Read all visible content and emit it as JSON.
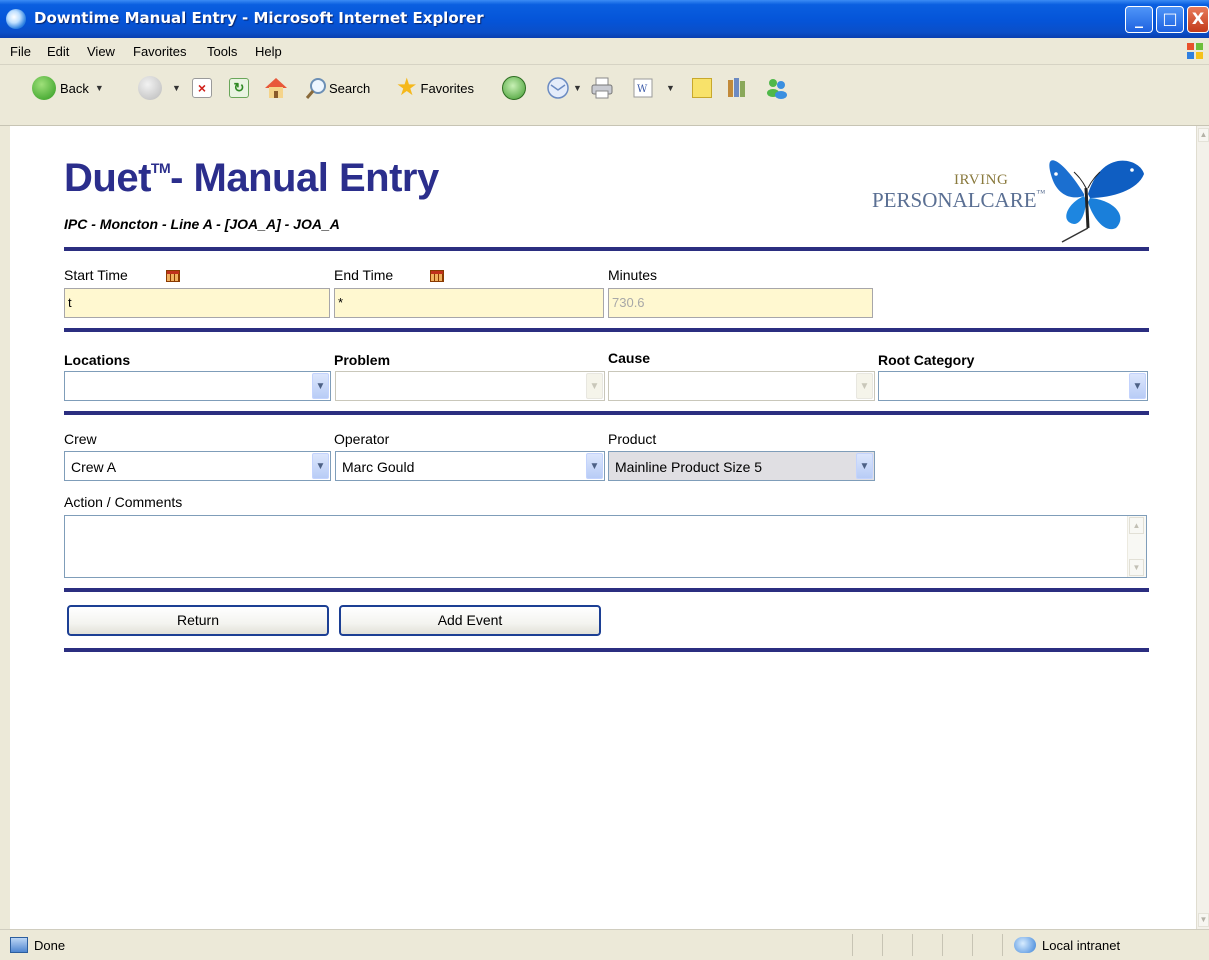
{
  "window": {
    "title": "Downtime Manual Entry - Microsoft Internet Explorer",
    "controls": {
      "minimize": "_",
      "maximize": "□",
      "close": "X"
    }
  },
  "menu": [
    "File",
    "Edit",
    "View",
    "Favorites",
    "Tools",
    "Help"
  ],
  "toolbar": {
    "back_label": "Back",
    "search_label": "Search",
    "favorites_label": "Favorites"
  },
  "page": {
    "title": "Duet",
    "title_tm": "TM",
    "title_rest": "- Manual Entry",
    "subtitle": "IPC - Moncton - Line A - [JOA_A] - JOA_A",
    "logo_line1": "IRVING",
    "logo_line2": "PERSONALCARE",
    "logo_tm": "™"
  },
  "form": {
    "start_time": {
      "label": "Start Time",
      "value": "t"
    },
    "end_time": {
      "label": "End Time",
      "value": "*"
    },
    "minutes": {
      "label": "Minutes",
      "value": "730.6"
    },
    "locations": {
      "label": "Locations",
      "value": ""
    },
    "problem": {
      "label": "Problem",
      "value": ""
    },
    "cause": {
      "label": "Cause",
      "value": ""
    },
    "root_category": {
      "label": "Root Category",
      "value": ""
    },
    "crew": {
      "label": "Crew",
      "value": "Crew A"
    },
    "operator": {
      "label": "Operator",
      "value": "Marc Gould"
    },
    "product": {
      "label": "Product",
      "value": "Mainline Product Size 5"
    },
    "comments": {
      "label": "Action / Comments",
      "value": ""
    }
  },
  "buttons": {
    "return_label": "Return",
    "add_event_label": "Add Event"
  },
  "status": {
    "text": "Done",
    "zone": "Local intranet"
  },
  "colors": {
    "accent": "#2b2e80",
    "title": "#2b2e8c",
    "input_bg": "#fff8d0"
  }
}
